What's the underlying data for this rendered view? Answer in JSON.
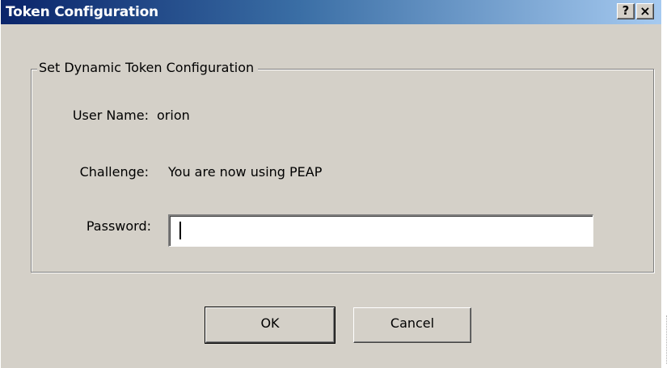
{
  "window": {
    "title": "Token Configuration",
    "help_label": "?",
    "close_label": "×",
    "colors": {
      "titlebar_start": "#0a246a",
      "titlebar_end": "#a6caf0",
      "face": "#d4d0c8"
    }
  },
  "group": {
    "legend": "Set Dynamic Token Configuration"
  },
  "fields": {
    "user_name_label": "User Name:",
    "user_name_value": "orion",
    "challenge_label": "Challenge:",
    "challenge_value": "You are now using PEAP",
    "password_label": "Password:",
    "password_value": ""
  },
  "buttons": {
    "ok_label": "OK",
    "cancel_label": "Cancel"
  },
  "icons": {
    "help": "question-mark-icon",
    "close": "close-x-icon"
  }
}
